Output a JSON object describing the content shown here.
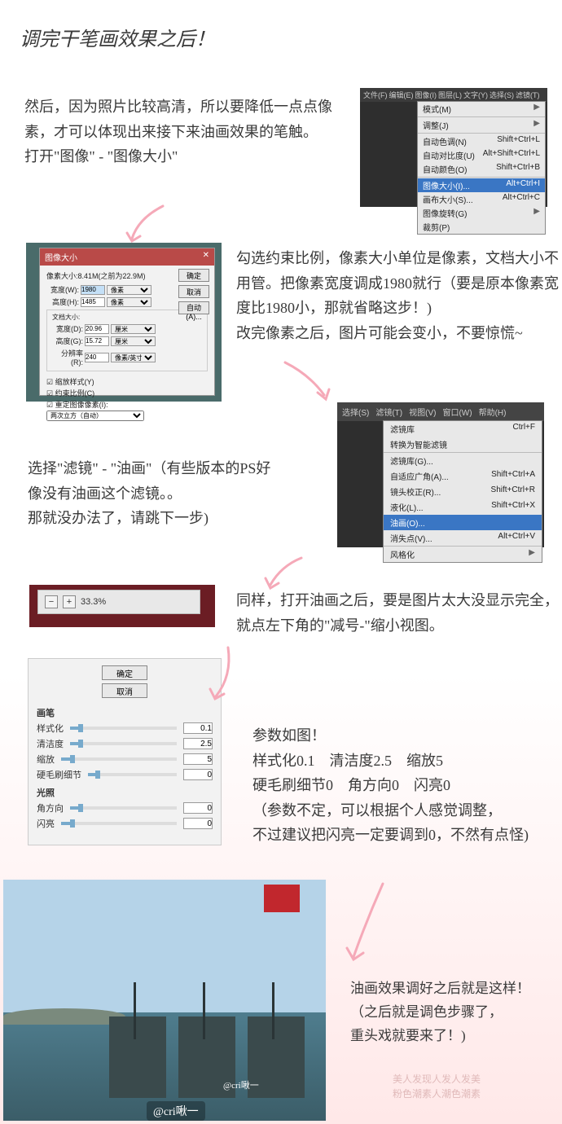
{
  "title": "调完干笔画效果之后！",
  "paragraphs": {
    "p1": "然后，因为照片比较高清，所以要降低一点点像素，才可以体现出来接下来油画效果的笔触。\n打开\"图像\" - \"图像大小\"",
    "p2": "勾选约束比例，像素大小单位是像素，文档大小不用管。把像素宽度调成1980就行（要是原本像素宽度比1980小，那就省略这步！)\n改完像素之后，图片可能会变小，不要惊慌~",
    "p3": "选择\"滤镜\" - \"油画\"（有些版本的PS好像没有油画这个滤镜。。\n那就没办法了，请跳下一步)",
    "p4": "同样，打开油画之后，要是图片太大没显示完全，就点左下角的\"减号-\"缩小视图。",
    "p5": "参数如图！\n样式化0.1　清洁度2.5　缩放5\n硬毛刷细节0　角方向0　闪亮0\n（参数不定，可以根据个人感觉调整，\n不过建议把闪亮一定要调到0，不然有点怪)",
    "p6": "油画效果调好之后就是这样！\n（之后就是调色步骤了，\n重头戏就要来了！)"
  },
  "menu1": {
    "bar": [
      "文件(F)",
      "编辑(E)",
      "图像(I)",
      "图层(L)",
      "文字(Y)",
      "选择(S)",
      "滤镜(T)"
    ],
    "items": [
      {
        "l": "模式(M)",
        "r": "▶"
      },
      {
        "sep": true
      },
      {
        "l": "调整(J)",
        "r": "▶"
      },
      {
        "sep": true
      },
      {
        "l": "自动色调(N)",
        "r": "Shift+Ctrl+L"
      },
      {
        "l": "自动对比度(U)",
        "r": "Alt+Shift+Ctrl+L"
      },
      {
        "l": "自动颜色(O)",
        "r": "Shift+Ctrl+B"
      },
      {
        "sep": true
      },
      {
        "l": "图像大小(I)...",
        "r": "Alt+Ctrl+I",
        "hi": true
      },
      {
        "l": "画布大小(S)...",
        "r": "Alt+Ctrl+C"
      },
      {
        "l": "图像旋转(G)",
        "r": "▶"
      },
      {
        "l": "裁剪(P)",
        "r": ""
      }
    ]
  },
  "imgsize": {
    "title": "图像大小",
    "close": "✕",
    "info": "像素大小:8.41M(之前为22.9M)",
    "width_l": "宽度(W):",
    "width_v": "1980",
    "height_l": "高度(H):",
    "height_v": "1485",
    "unit_px": "像素",
    "docsize": "文档大小:",
    "dw_l": "宽度(D):",
    "dw_v": "20.96",
    "dh_l": "高度(G):",
    "dh_v": "15.72",
    "unit_cm": "厘米",
    "res_l": "分辨率(R):",
    "res_v": "240",
    "res_u": "像素/英寸",
    "ok": "确定",
    "cancel": "取消",
    "auto": "自动(A)...",
    "c1": "☑ 缩放样式(Y)",
    "c2": "☑ 约束比例(C)",
    "c3": "☑ 重定图像像素(I):",
    "resample": "两次立方（自动）"
  },
  "menu2": {
    "bar": [
      "选择(S)",
      "滤镜(T)",
      "视图(V)",
      "窗口(W)",
      "帮助(H)"
    ],
    "items": [
      {
        "l": "滤镜库",
        "r": "Ctrl+F"
      },
      {
        "l": "转换为智能滤镜",
        "r": ""
      },
      {
        "sep": true
      },
      {
        "l": "滤镜库(G)...",
        "r": ""
      },
      {
        "l": "自适应广角(A)...",
        "r": "Shift+Ctrl+A"
      },
      {
        "l": "镜头校正(R)...",
        "r": "Shift+Ctrl+R"
      },
      {
        "l": "液化(L)...",
        "r": "Shift+Ctrl+X"
      },
      {
        "l": "油画(O)...",
        "r": "",
        "hi": true
      },
      {
        "l": "消失点(V)...",
        "r": "Alt+Ctrl+V"
      },
      {
        "sep": true
      },
      {
        "l": "风格化",
        "r": "▶"
      }
    ]
  },
  "zoom": {
    "value": "33.3%"
  },
  "oil": {
    "ok": "确定",
    "cancel": "取消",
    "g1": "画笔",
    "g2": "光照",
    "stylization_l": "样式化",
    "stylization_v": "0.1",
    "cleanliness_l": "清洁度",
    "cleanliness_v": "2.5",
    "scale_l": "缩放",
    "scale_v": "5",
    "bristle_l": "硬毛刷细节",
    "bristle_v": "0",
    "angle_l": "角方向",
    "angle_v": "0",
    "shine_l": "闪亮",
    "shine_v": "0"
  },
  "watermark": "美人发现人发人发美\n粉色潮素人潮色潮素",
  "credit": "@cri啾一",
  "credit2": "@cri啾一"
}
